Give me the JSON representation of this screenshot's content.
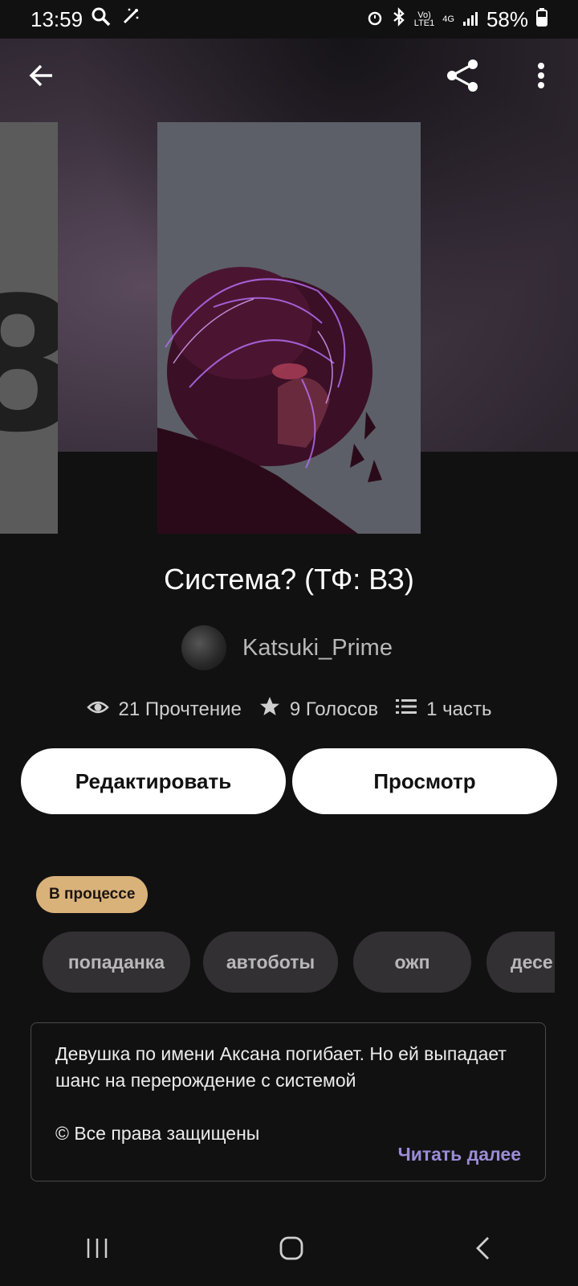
{
  "status_bar": {
    "time": "13:59",
    "battery": "58%",
    "network_top": "Vo)",
    "network_bottom": "LTE1",
    "signal_label": "4G"
  },
  "header": {
    "back_icon": "arrow-left-icon",
    "share_icon": "share-icon",
    "more_icon": "more-vertical-icon"
  },
  "story": {
    "title": "Система? (ТФ: ВЗ)",
    "author": "Katsuki_Prime",
    "reads": "21 Прочтение",
    "votes": "9 Голосов",
    "parts": "1 часть"
  },
  "actions": {
    "edit_label": "Редактировать",
    "preview_label": "Просмотр"
  },
  "status_badge": "В процессе",
  "tags": [
    "попаданка",
    "автоботы",
    "ожп",
    "десе"
  ],
  "description": {
    "text": "Девушка по имени Аксана погибает. Но ей выпадает шанс на перерождение с системой",
    "copyright": "© Все права защищены",
    "read_more": "Читать далее"
  },
  "colors": {
    "background": "#121112",
    "badge": "#d9b27a",
    "link": "#9b8cd6",
    "tag_bg": "#333034"
  },
  "navigation": {
    "recent_icon": "recent-apps-icon",
    "home_icon": "home-icon",
    "back_icon": "back-icon"
  }
}
